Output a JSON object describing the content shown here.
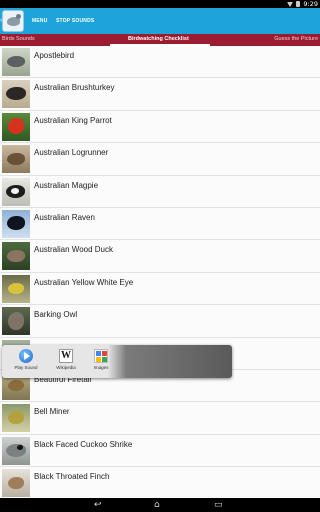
{
  "status_bar": {
    "time": "9:29"
  },
  "action_bar": {
    "menu_label": "MENU",
    "stop_sounds_label": "STOP SOUNDS",
    "bg_color": "#1ea4d9"
  },
  "tabs": [
    {
      "label": "Birds Sounds",
      "active": false
    },
    {
      "label": "Birdwatching Checklist",
      "active": true
    },
    {
      "label": "Guess the Picture",
      "active": false
    }
  ],
  "tab_color": "#9b1b30",
  "birds": [
    {
      "name": "Apostlebird"
    },
    {
      "name": "Australian Brushturkey"
    },
    {
      "name": "Australian King Parrot"
    },
    {
      "name": "Australian Logrunner"
    },
    {
      "name": "Australian Magpie"
    },
    {
      "name": "Australian Raven"
    },
    {
      "name": "Australian Wood Duck"
    },
    {
      "name": "Australian Yellow White Eye"
    },
    {
      "name": "Barking Owl"
    },
    {
      "name": ""
    },
    {
      "name": "Beautiful Firetail"
    },
    {
      "name": "Bell Miner"
    },
    {
      "name": "Black Faced Cuckoo Shrike"
    },
    {
      "name": "Black Throated Finch"
    }
  ],
  "popup": {
    "play_sound_label": "Play Sound",
    "wikipedia_label": "Wikipedia",
    "images_label": "Images"
  }
}
